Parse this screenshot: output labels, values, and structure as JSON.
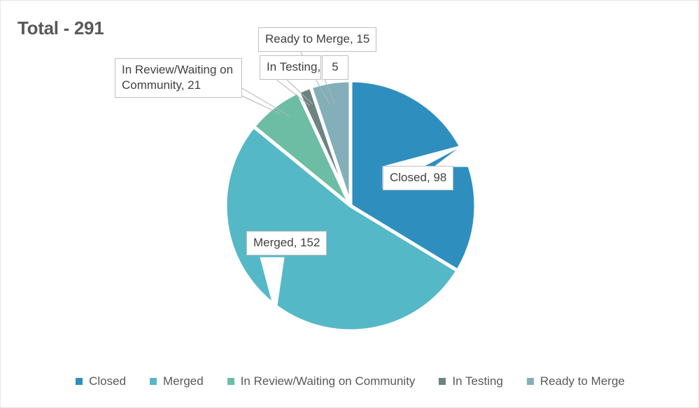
{
  "chart_data": {
    "type": "pie",
    "title": "Total - 291",
    "total": 291,
    "categories": [
      "Closed",
      "Merged",
      "In Review/Waiting on Community",
      "In Testing",
      "Ready to Merge"
    ],
    "values": [
      98,
      152,
      21,
      5,
      15
    ],
    "colors": [
      "#2E8FBE",
      "#55B8C7",
      "#6DBDA5",
      "#6C8381",
      "#83AFB9"
    ],
    "start_angle_deg": 0,
    "direction": "clockwise",
    "legend_position": "bottom",
    "grid": false,
    "data_labels": [
      "Closed, 98",
      "Merged, 152",
      "In Review/Waiting on Community, 21",
      "In Testing, 5",
      "Ready to Merge, 15"
    ]
  },
  "title": {
    "text": "Total - 291"
  },
  "labels": {
    "closed": "Closed, 98",
    "merged": "Merged, 152",
    "in_review": "In Review/Waiting on Community, 21",
    "in_testing": "In Testing,",
    "in_testing_value": "5",
    "ready_to_merge": "Ready to Merge, 15"
  },
  "legend": {
    "items": [
      {
        "label": "Closed",
        "color": "#2E8FBE"
      },
      {
        "label": "Merged",
        "color": "#55B8C7"
      },
      {
        "label": "In Review/Waiting on Community",
        "color": "#6DBDA5"
      },
      {
        "label": "In Testing",
        "color": "#6C8381"
      },
      {
        "label": "Ready to Merge",
        "color": "#83AFB9"
      }
    ]
  }
}
